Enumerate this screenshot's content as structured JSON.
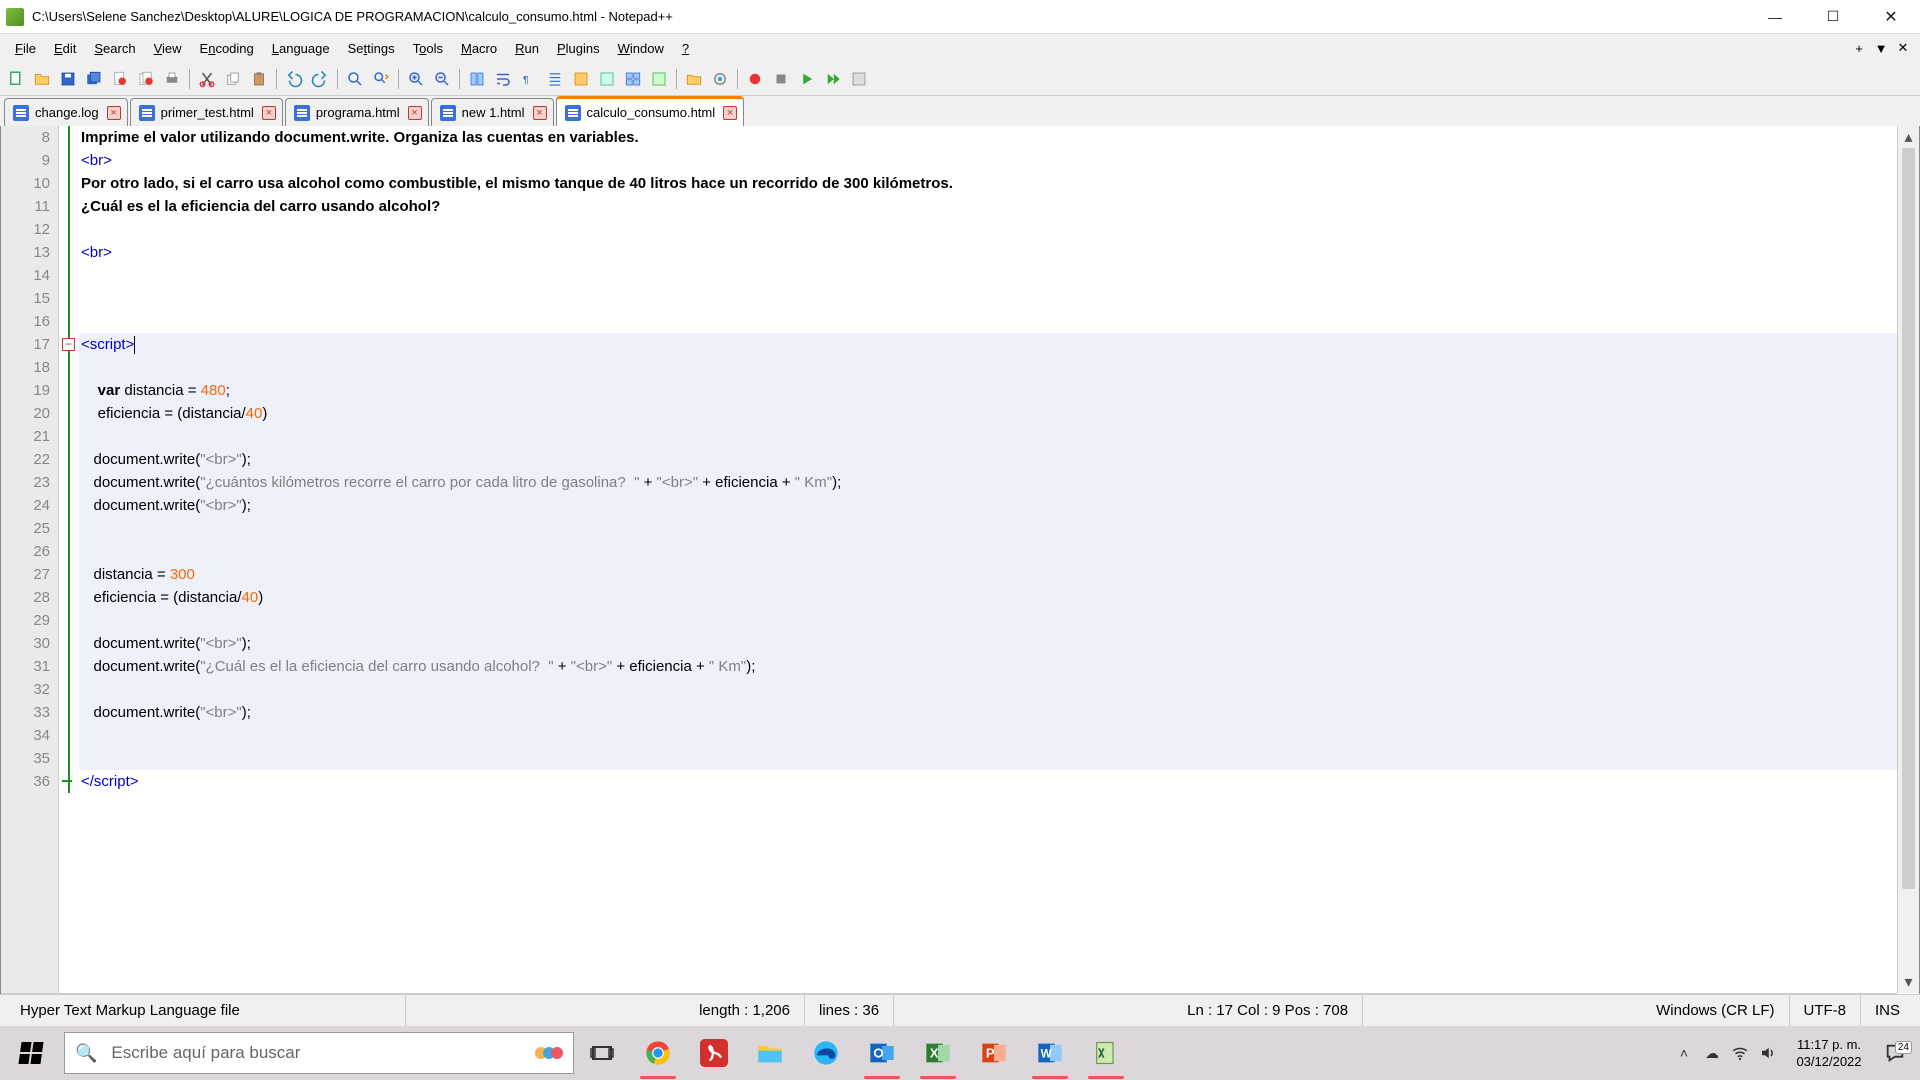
{
  "title": "C:\\Users\\Selene Sanchez\\Desktop\\ALURE\\LOGICA DE PROGRAMACION\\calculo_consumo.html - Notepad++",
  "menus": [
    "File",
    "Edit",
    "Search",
    "View",
    "Encoding",
    "Language",
    "Settings",
    "Tools",
    "Macro",
    "Run",
    "Plugins",
    "Window",
    "?"
  ],
  "menu_underlines": [
    "F",
    "E",
    "S",
    "V",
    "n",
    "L",
    "t",
    "o",
    "M",
    "R",
    "P",
    "W",
    "?"
  ],
  "extra_buttons": [
    "+",
    "▼",
    "✕"
  ],
  "tabs": [
    {
      "label": "change.log",
      "active": false
    },
    {
      "label": "primer_test.html",
      "active": false
    },
    {
      "label": "programa.html",
      "active": false
    },
    {
      "label": "new 1.html",
      "active": false
    },
    {
      "label": "calculo_consumo.html",
      "active": true
    }
  ],
  "line_start": 8,
  "line_end": 36,
  "current_line": 17,
  "code_lines": [
    {
      "n": 8,
      "tokens": [
        {
          "t": "Imprime el valor utilizando document.write. Organiza las cuentas en variables.",
          "c": "kw-bold"
        }
      ]
    },
    {
      "n": 9,
      "tokens": [
        {
          "t": "<br>",
          "c": "kw-blue"
        }
      ]
    },
    {
      "n": 10,
      "tokens": [
        {
          "t": "Por otro lado, si el carro usa alcohol como combustible, el mismo tanque de 40 litros hace un recorrido de 300 kilómetros.",
          "c": "kw-bold"
        }
      ]
    },
    {
      "n": 11,
      "tokens": [
        {
          "t": "¿Cuál es el la eficiencia del carro usando alcohol?",
          "c": "kw-bold"
        }
      ]
    },
    {
      "n": 12,
      "tokens": []
    },
    {
      "n": 13,
      "tokens": [
        {
          "t": "<br>",
          "c": "kw-blue"
        }
      ]
    },
    {
      "n": 14,
      "tokens": []
    },
    {
      "n": 15,
      "tokens": []
    },
    {
      "n": 16,
      "tokens": []
    },
    {
      "n": 17,
      "fold": "open",
      "tokens": [
        {
          "t": "<script>",
          "c": "kw-blue"
        }
      ]
    },
    {
      "n": 18,
      "tokens": []
    },
    {
      "n": 19,
      "tokens": [
        {
          "t": "    ",
          "c": "dflt"
        },
        {
          "t": "var",
          "c": "kw-blue kw-bold"
        },
        {
          "t": " distancia = ",
          "c": "dflt"
        },
        {
          "t": "480",
          "c": "num"
        },
        {
          "t": ";",
          "c": "dflt"
        }
      ]
    },
    {
      "n": 20,
      "tokens": [
        {
          "t": "    eficiencia = (distancia/",
          "c": "dflt"
        },
        {
          "t": "40",
          "c": "num"
        },
        {
          "t": ")",
          "c": "dflt"
        }
      ]
    },
    {
      "n": 21,
      "tokens": []
    },
    {
      "n": 22,
      "tokens": [
        {
          "t": "   document.write(",
          "c": "dflt"
        },
        {
          "t": "\"<br>\"",
          "c": "str"
        },
        {
          "t": ");",
          "c": "dflt"
        }
      ]
    },
    {
      "n": 23,
      "tokens": [
        {
          "t": "   document.write(",
          "c": "dflt"
        },
        {
          "t": "\"¿cuántos kilómetros recorre el carro por cada litro de gasolina?  \"",
          "c": "str"
        },
        {
          "t": " + ",
          "c": "dflt"
        },
        {
          "t": "\"<br>\"",
          "c": "str"
        },
        {
          "t": " + eficiencia + ",
          "c": "dflt"
        },
        {
          "t": "\" Km\"",
          "c": "str"
        },
        {
          "t": ");",
          "c": "dflt"
        }
      ]
    },
    {
      "n": 24,
      "tokens": [
        {
          "t": "   document.write(",
          "c": "dflt"
        },
        {
          "t": "\"<br>\"",
          "c": "str"
        },
        {
          "t": ");",
          "c": "dflt"
        }
      ]
    },
    {
      "n": 25,
      "tokens": []
    },
    {
      "n": 26,
      "tokens": []
    },
    {
      "n": 27,
      "tokens": [
        {
          "t": "   distancia = ",
          "c": "dflt"
        },
        {
          "t": "300",
          "c": "num"
        }
      ]
    },
    {
      "n": 28,
      "tokens": [
        {
          "t": "   eficiencia = (distancia/",
          "c": "dflt"
        },
        {
          "t": "40",
          "c": "num"
        },
        {
          "t": ")",
          "c": "dflt"
        }
      ]
    },
    {
      "n": 29,
      "tokens": []
    },
    {
      "n": 30,
      "tokens": [
        {
          "t": "   document.write(",
          "c": "dflt"
        },
        {
          "t": "\"<br>\"",
          "c": "str"
        },
        {
          "t": ");",
          "c": "dflt"
        }
      ]
    },
    {
      "n": 31,
      "tokens": [
        {
          "t": "   document.write(",
          "c": "dflt"
        },
        {
          "t": "\"¿Cuál es el la eficiencia del carro usando alcohol?  \"",
          "c": "str"
        },
        {
          "t": " + ",
          "c": "dflt"
        },
        {
          "t": "\"<br>\"",
          "c": "str"
        },
        {
          "t": " + eficiencia + ",
          "c": "dflt"
        },
        {
          "t": "\" Km\"",
          "c": "str"
        },
        {
          "t": ");",
          "c": "dflt"
        }
      ]
    },
    {
      "n": 32,
      "tokens": []
    },
    {
      "n": 33,
      "tokens": [
        {
          "t": "   document.write(",
          "c": "dflt"
        },
        {
          "t": "\"<br>\"",
          "c": "str"
        },
        {
          "t": ");",
          "c": "dflt"
        }
      ]
    },
    {
      "n": 34,
      "tokens": []
    },
    {
      "n": 35,
      "tokens": []
    },
    {
      "n": 36,
      "foldend": true,
      "tokens": [
        {
          "t": "</script>",
          "c": "kw-blue"
        }
      ]
    }
  ],
  "status": {
    "lang": "Hyper Text Markup Language file",
    "length": "length : 1,206",
    "lines": "lines : 36",
    "pos": "Ln : 17   Col : 9   Pos : 708",
    "eol": "Windows (CR LF)",
    "enc": "UTF-8",
    "ins": "INS"
  },
  "taskbar": {
    "search_placeholder": "Escribe aquí para buscar",
    "clock_time": "11:17 p. m.",
    "clock_date": "03/12/2022",
    "notif_badge": "24"
  }
}
